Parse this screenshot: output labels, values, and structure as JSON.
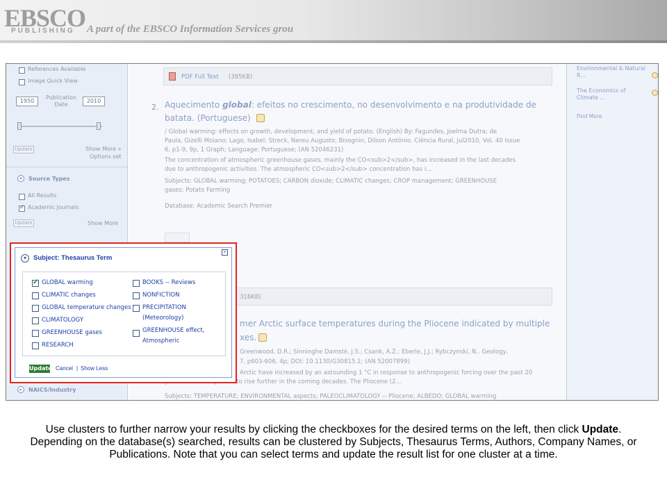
{
  "banner": {
    "logo_text": "EBSCO",
    "logo_sub": "PUBLISHING",
    "tagline": "A part of the EBSCO Information Services grou"
  },
  "left_panel": {
    "limiters": [
      "References Available",
      "Image Quick View"
    ],
    "pub_date_label": "Publication Date",
    "pub_date_from": "1950",
    "pub_date_to": "2010",
    "update_label": "Update",
    "show_more": "Show More »",
    "options_set": "Options set",
    "source_types_title": "Source Types",
    "source_types": [
      {
        "label": "All Results",
        "checked": false
      },
      {
        "label": "Academic Journals",
        "checked": true
      }
    ],
    "source_show_more": "Show More",
    "naics_title": "NAICS/Industry"
  },
  "results": {
    "pdf_label": "PDF Full Text",
    "pdf_size": "(395KB)",
    "item2_number": "2.",
    "item2_title_a": "Aquecimento ",
    "item2_title_em": "global",
    "item2_title_b": ": efeitos no crescimento, no desenvolvimento e na produtividade de",
    "item2_title_c": "batata. (Portuguese)",
    "item2_meta1": "/ Global warming: effects on growth, development, and yield of potato. (English) By: Fagundes, Joelma Dutra; de",
    "item2_meta2": "Paula, Gizelli Moiano; Lago, Isabel; Streck, Nereu Augusto; Bisognin, Dilson Antônio. Ciência Rural, jul2010, Vol. 40 Issue",
    "item2_meta3": "6, p1-9, 9p, 1 Graph; Language: Portuguese; (AN 52046231)",
    "item2_abs1": "The concentration of atmospheric greenhouse gases, mainly the CO<sub>2</sub>, has increased in the last decades",
    "item2_abs2": "due to anthropogenic activities. The atmospheric CO<sub>2</sub> concentration has i...",
    "item2_subj1": "Subjects: GLOBAL warming; POTATOES; CARBON dioxide; CLIMATIC changes; CROP management; GREENHOUSE",
    "item2_subj2": "gases; Potato Farming",
    "item2_db": "Database: Academic Search Premier",
    "item3_pdf_size": "316KB)",
    "item3_title1": "mer Arctic surface temperatures during the Pliocene indicated by multiple",
    "item3_title2": "xes.",
    "item3_meta1": "Greenwood, D.R.; Sinninghe Damsté, J.S.; Csank, A.Z.; Eberle, J.J.; Rybczynski, N.. Geology,",
    "item3_meta2": "7, p603-606, 4p; DOI: 10.1130/G30815.1; (AN 52007899)",
    "item3_abs1": "Arctic have increased by an astounding 1 °C in response to anthropogenic forcing over the past 20",
    "item3_abs2": "years and are expected to rise further in the coming decades. The Pliocene (2...",
    "item3_subj": "Subjects: TEMPERATURE; ENVIRONMENTAL aspects; PALEOCLIMATOLOGY -- Pliocene; ALBEDO; GLOBAL warming"
  },
  "right_panel": {
    "items": [
      "Environmental & Natural R...",
      "The Economics of Climate ..."
    ],
    "find_more": "Find More"
  },
  "popup": {
    "title": "Subject: Thesaurus Term",
    "left_terms": [
      {
        "label": "GLOBAL warming",
        "checked": true
      },
      {
        "label": "CLIMATIC changes",
        "checked": false
      },
      {
        "label": "GLOBAL temperature changes",
        "checked": false
      },
      {
        "label": "CLIMATOLOGY",
        "checked": false
      },
      {
        "label": "GREENHOUSE gases",
        "checked": false
      },
      {
        "label": "RESEARCH",
        "checked": false
      }
    ],
    "right_terms": [
      {
        "label": "BOOKS -- Reviews",
        "checked": false
      },
      {
        "label": "NONFICTION",
        "checked": false
      },
      {
        "label": "PRECIPITATION (Meteorology)",
        "line1": "PRECIPITATION",
        "line2": "(Meteorology)",
        "checked": false
      },
      {
        "label": "GREENHOUSE effect, Atmospheric",
        "line1": "GREENHOUSE effect,",
        "line2": "Atmospheric",
        "checked": false
      }
    ],
    "update_button": "Update",
    "cancel_link": "Cancel",
    "separator": "|",
    "show_less_link": "Show Less"
  },
  "caption": {
    "part1": "Use clusters to further narrow your results by clicking the checkboxes for the desired terms on the left, then click ",
    "bold": "Update",
    "part2": ". Depending on the database(s) searched, results can be clustered by Subjects, Thesaurus Terms, Authors, Company Names, or Publications. Note that you can select terms and update the result list for one cluster at a time."
  },
  "colors": {
    "highlight_border": "#e0261d",
    "link_blue": "#1c3ea8",
    "update_green": "#2d7d33"
  }
}
